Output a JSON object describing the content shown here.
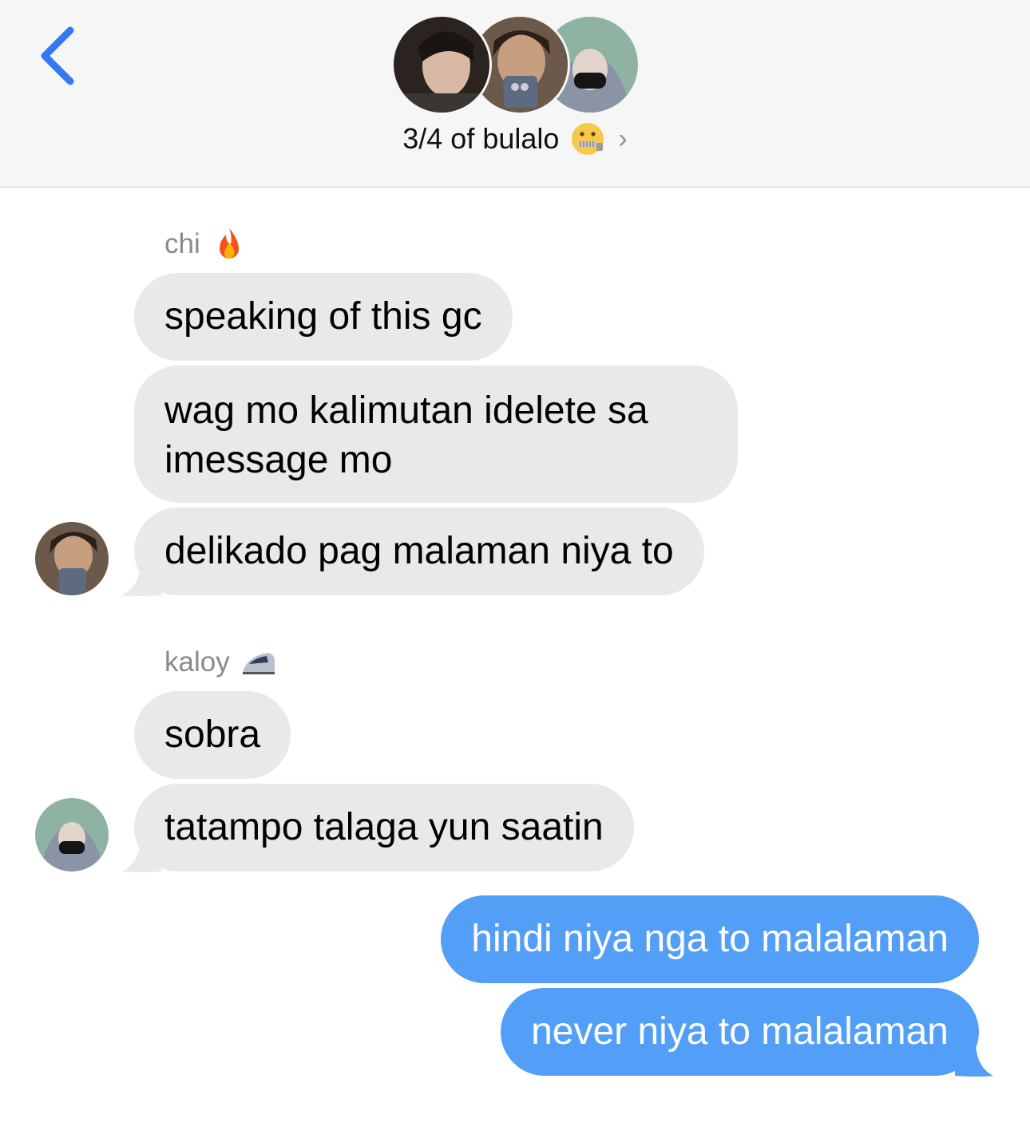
{
  "header": {
    "group_name": "3/4 of bulalo",
    "group_emoji": "zipper-mouth-face-icon",
    "chevron": "›"
  },
  "colors": {
    "incoming_bubble": "#e9e9eb",
    "outgoing_bubble": "#539ff7",
    "accent_blue": "#3478f6",
    "sender_label": "#8a8a8e"
  },
  "messages": [
    {
      "sender": "chi",
      "sender_emoji": "fire-icon",
      "text": "speaking of this gc",
      "direction": "in"
    },
    {
      "sender": "chi",
      "text": "wag mo kalimutan idelete sa imessage mo",
      "direction": "in"
    },
    {
      "sender": "chi",
      "text": "delikado pag malaman niya to",
      "direction": "in"
    },
    {
      "sender": "kaloy",
      "sender_emoji": "bullet-train-icon",
      "text": "sobra",
      "direction": "in"
    },
    {
      "sender": "kaloy",
      "text": "tatampo talaga yun saatin",
      "direction": "in"
    },
    {
      "sender": "me",
      "text": "hindi niya nga to malalaman",
      "direction": "out"
    },
    {
      "sender": "me",
      "text": "never niya to malalaman",
      "direction": "out"
    }
  ]
}
